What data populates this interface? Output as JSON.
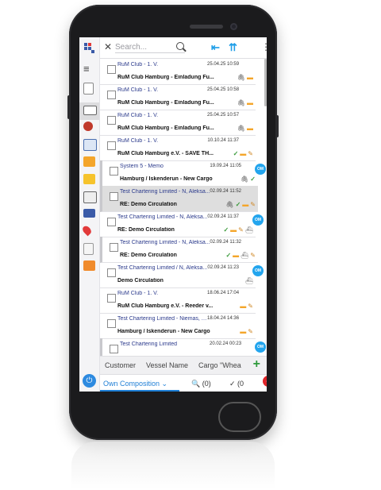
{
  "search": {
    "placeholder": "Search..."
  },
  "toolbar": {
    "close_glyph": "✕",
    "collapse_glyph": "⇤",
    "expand_glyph": "⇈",
    "menu_glyph": "⋮"
  },
  "messages": [
    {
      "from": "RuM Club - 1. V.",
      "date": "25.04.25 10:59",
      "subject": "RuM Club Hamburg - Einladung Fu...",
      "icons": [
        "clip",
        "folder"
      ]
    },
    {
      "from": "RuM Club - 1. V.",
      "date": "25.04.25 10:58",
      "subject": "RuM Club Hamburg - Einladung Fu...",
      "icons": [
        "clip",
        "folder"
      ]
    },
    {
      "from": "RuM Club - 1. V.",
      "date": "25.04.25 10:57",
      "subject": "RuM Club Hamburg - Einladung Fu...",
      "icons": [
        "clip",
        "folder"
      ]
    },
    {
      "from": "RuM Club - 1. V.",
      "date": "10.10.24 11:37",
      "subject": "RuM Club Hamburg e.V. - SAVE TH...",
      "icons": [
        "check",
        "folder",
        "pencil"
      ]
    },
    {
      "from": "System 5 - Memo",
      "date": "19.09.24 11:05",
      "subject": "Hamburg / Iskenderun - New Cargo",
      "icons": [
        "clip",
        "check"
      ],
      "avatar": "OM",
      "flag": true
    },
    {
      "from": "Test Chartering Limited - N, Aleksa...",
      "date": "02.09.24 11:52",
      "subject": "RE: Demo Circulation",
      "icons": [
        "clip",
        "check",
        "folder",
        "pencil"
      ],
      "selected": true,
      "flag": true
    },
    {
      "from": "Test Chartering Limited - N, Aleksa...",
      "date": "02.09.24 11:37",
      "subject": "RE: Demo Circulation",
      "icons": [
        "check",
        "folder",
        "pencil",
        "ship"
      ],
      "avatar": "OM"
    },
    {
      "from": "Test Chartering Limited - N, Aleksa...",
      "date": "02.09.24 11:32",
      "subject": "RE: Demo Circulation",
      "icons": [
        "check",
        "folder",
        "ship",
        "pencil"
      ],
      "flag": true
    },
    {
      "from": "Test Chartering Limited / N, Aleksa...",
      "date": "02.09.24 11:23",
      "subject": "Demo Circulation",
      "icons": [
        "ship"
      ],
      "avatar": "OM"
    },
    {
      "from": "RuM Club - 1. V.",
      "date": "18.06.24 17:04",
      "subject": "RuM Club Hamburg e.V. - Reeder v...",
      "icons": [
        "folder",
        "pencil"
      ]
    },
    {
      "from": "Test Chartering Limited - Niemas, A...",
      "date": "18.04.24 14:36",
      "subject": "Hamburg / Iskenderun - New Cargo",
      "icons": [
        "folder",
        "pencil"
      ]
    },
    {
      "from": "Test Chartering Limited",
      "date": "20.02.24 00:23",
      "subject": "",
      "icons": [],
      "avatar": "OM",
      "flag": true
    }
  ],
  "tabs": [
    "Customer",
    "Vessel Name",
    "Cargo \"Whea"
  ],
  "bottom": {
    "composition": "Own Composition",
    "search_count": "(0)",
    "check_count": "(0"
  },
  "colors": {
    "accent": "#1f9ee8",
    "link": "#2b3a8c",
    "fab": "#e0252a"
  }
}
